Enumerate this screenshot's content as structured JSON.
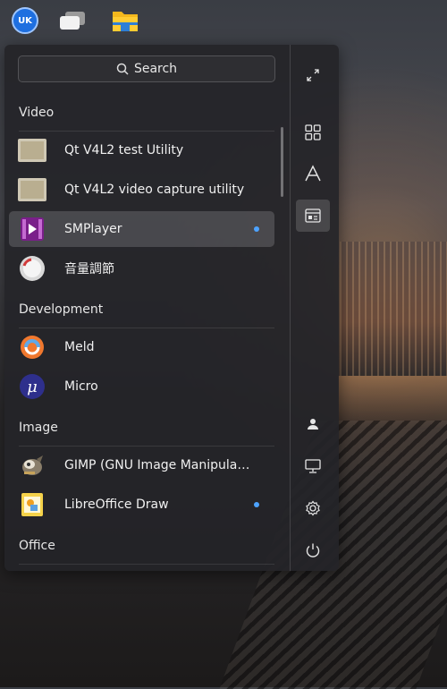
{
  "menu": {
    "search_placeholder": "Search",
    "sections": [
      {
        "title": "Video",
        "items": [
          {
            "label": "Qt V4L2 test Utility",
            "icon": "film-icon"
          },
          {
            "label": "Qt V4L2 video capture utility",
            "icon": "film-icon"
          },
          {
            "label": "SMPlayer",
            "icon": "smplayer-icon",
            "selected": true,
            "new": true
          },
          {
            "label": "音量調節",
            "icon": "volume-knob-icon"
          }
        ]
      },
      {
        "title": "Development",
        "items": [
          {
            "label": "Meld",
            "icon": "meld-icon"
          },
          {
            "label": "Micro",
            "icon": "micro-icon"
          }
        ]
      },
      {
        "title": "Image",
        "items": [
          {
            "label": "GIMP (GNU Image Manipulation…",
            "icon": "gimp-icon"
          },
          {
            "label": "LibreOffice Draw",
            "icon": "libreoffice-draw-icon",
            "new": true
          }
        ]
      },
      {
        "title": "Office",
        "items": []
      }
    ]
  },
  "topbar": {
    "start_logo_text": "UK",
    "icons": [
      "start-menu-icon",
      "show-windows-icon",
      "file-manager-icon"
    ]
  },
  "sidebar": {
    "icons": [
      "expand-icon",
      "grid-view-icon",
      "letter-view-icon",
      "category-view-icon",
      "user-icon",
      "computer-icon",
      "settings-icon",
      "power-icon"
    ],
    "active": "category-view-icon"
  },
  "colors": {
    "accent": "#4da3ff",
    "menu_bg": "#242428"
  }
}
